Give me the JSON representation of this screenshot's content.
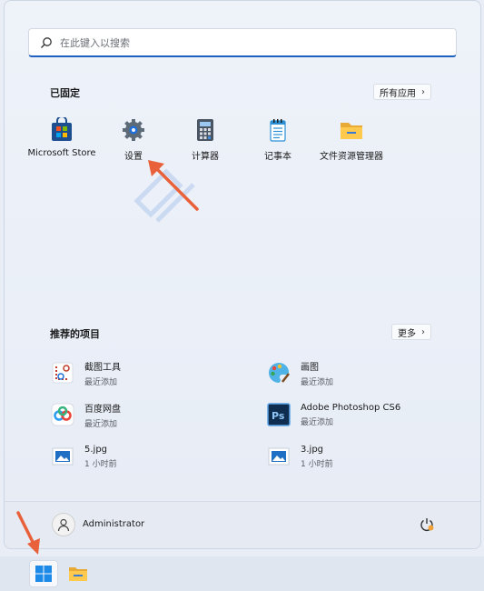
{
  "search": {
    "placeholder": "在此键入以搜索"
  },
  "pinned": {
    "title": "已固定",
    "all_apps_label": "所有应用",
    "items": [
      {
        "label": "Microsoft Store",
        "icon": "store-icon"
      },
      {
        "label": "设置",
        "icon": "gear-icon"
      },
      {
        "label": "计算器",
        "icon": "calculator-icon"
      },
      {
        "label": "记事本",
        "icon": "notepad-icon"
      },
      {
        "label": "文件资源管理器",
        "icon": "folder-icon"
      }
    ]
  },
  "recommended": {
    "title": "推荐的项目",
    "more_label": "更多",
    "items": [
      {
        "name": "截图工具",
        "sub": "最近添加",
        "icon": "snipping-tool-icon"
      },
      {
        "name": "画图",
        "sub": "最近添加",
        "icon": "paint-icon"
      },
      {
        "name": "百度网盘",
        "sub": "最近添加",
        "icon": "baidu-netdisk-icon"
      },
      {
        "name": "Adobe Photoshop CS6",
        "sub": "最近添加",
        "icon": "photoshop-icon"
      },
      {
        "name": "5.jpg",
        "sub": "1 小时前",
        "icon": "image-file-icon"
      },
      {
        "name": "3.jpg",
        "sub": "1 小时前",
        "icon": "image-file-icon"
      }
    ]
  },
  "user": {
    "name": "Administrator"
  },
  "taskbar": {
    "items": [
      "start-icon",
      "file-explorer-icon"
    ]
  },
  "colors": {
    "accent": "#1f5fbf",
    "arrow": "#e8613a"
  }
}
